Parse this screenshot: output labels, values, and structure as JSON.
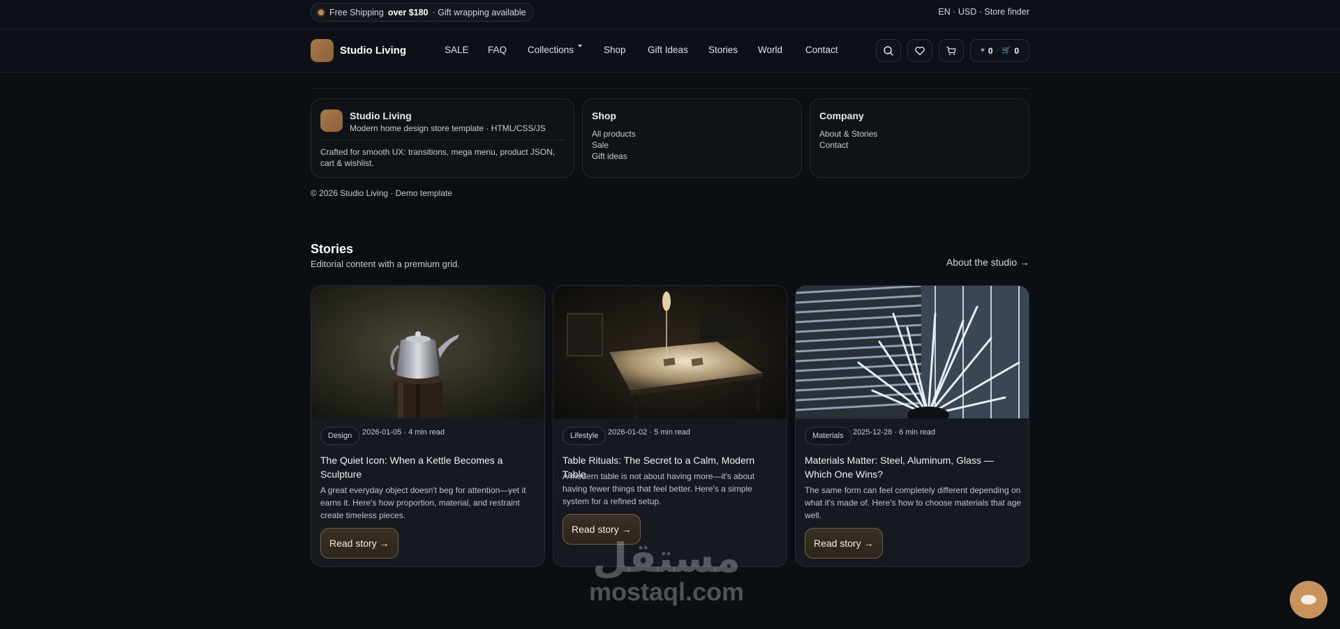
{
  "topbar": {
    "promo_a": "Free Shipping",
    "promo_b": "over $180",
    "promo_c": "· Gift wrapping available",
    "locale": "EN · USD · Store finder"
  },
  "header": {
    "brand": "Studio Living",
    "nav": [
      "SALE",
      "FAQ",
      "Collections",
      "Shop",
      "Gift Ideas",
      "Stories",
      "World",
      "Contact"
    ],
    "wishlist_count": "0",
    "cart_count": "0"
  },
  "panel": {
    "brand": "Studio Living",
    "brand_sub": "Modern home design store template · HTML/CSS/JS",
    "brand_desc": "Crafted for smooth UX: transitions, mega menu, product JSON, cart & wishlist.",
    "shop_title": "Shop",
    "shop_links": [
      "All products",
      "Sale",
      "Gift ideas"
    ],
    "company_title": "Company",
    "company_links": [
      "About & Stories",
      "Contact"
    ],
    "copyright": "© 2026 Studio Living · Demo template"
  },
  "stories": {
    "title": "Stories",
    "subtitle": "Editorial content with a premium grid.",
    "link": "About the studio →",
    "cards": [
      {
        "tag": "Design",
        "date": "2026-01-05",
        "read": "4 min read",
        "title": "The Quiet Icon: When a Kettle Becomes a Sculpture",
        "desc": "A great everyday object doesn't beg for attention—yet it earns it. Here's how proportion, material, and restraint create timeless pieces.",
        "cta": "Read story →"
      },
      {
        "tag": "Lifestyle",
        "date": "2026-01-02",
        "read": "5 min read",
        "title": "Table Rituals: The Secret to a Calm, Modern Table",
        "desc": "A modern table is not about having more—it's about having fewer things that feel better. Here's a simple system for a refined setup.",
        "cta": "Read story →"
      },
      {
        "tag": "Materials",
        "date": "2025-12-28",
        "read": "6 min read",
        "title": "Materials Matter: Steel, Aluminum, Glass — Which One Wins?",
        "desc": "The same form can feel completely different depending on what it's made of. Here's how to choose materials that age well.",
        "cta": "Read story →"
      }
    ]
  },
  "watermark": {
    "arabic": "مستقل",
    "latin": "mostaql.com"
  },
  "colors": {
    "background": "#0b0e13",
    "accent": "#c48a4a",
    "card": "#151a20"
  }
}
